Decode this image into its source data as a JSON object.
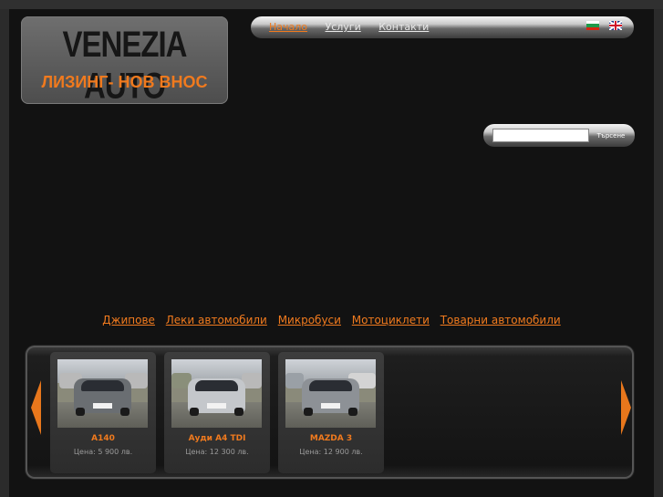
{
  "logo": {
    "title": "VENEZIA AUTO",
    "subtitle": "ЛИЗИНГ- НОВ ВНОС"
  },
  "nav": {
    "items": [
      {
        "label": "Начало",
        "active": true
      },
      {
        "label": "Услуги",
        "active": false
      },
      {
        "label": "Контакти",
        "active": false
      }
    ],
    "languages": [
      "flag-bg-icon",
      "flag-uk-icon"
    ]
  },
  "search": {
    "value": "",
    "button_label": "Търсене"
  },
  "categories": [
    "Джипове",
    "Леки автомобили",
    "Микробуси",
    "Мотоциклети",
    "Товарни автомобили"
  ],
  "listings": [
    {
      "name": "A140",
      "price": "Цена: 5 900 лв.",
      "car_color": "#6a6e72"
    },
    {
      "name": "Ауди A4 TDI",
      "price": "Цена: 12 300 лв.",
      "car_color": "#c4c7cb"
    },
    {
      "name": "MAZDA 3",
      "price": "Цена: 12 900 лв.",
      "car_color": "#8d9196"
    }
  ],
  "colors": {
    "accent": "#f07a1e",
    "background": "#121212"
  },
  "carousel": {
    "prev_icon": "arrow-left-icon",
    "next_icon": "arrow-right-icon"
  }
}
